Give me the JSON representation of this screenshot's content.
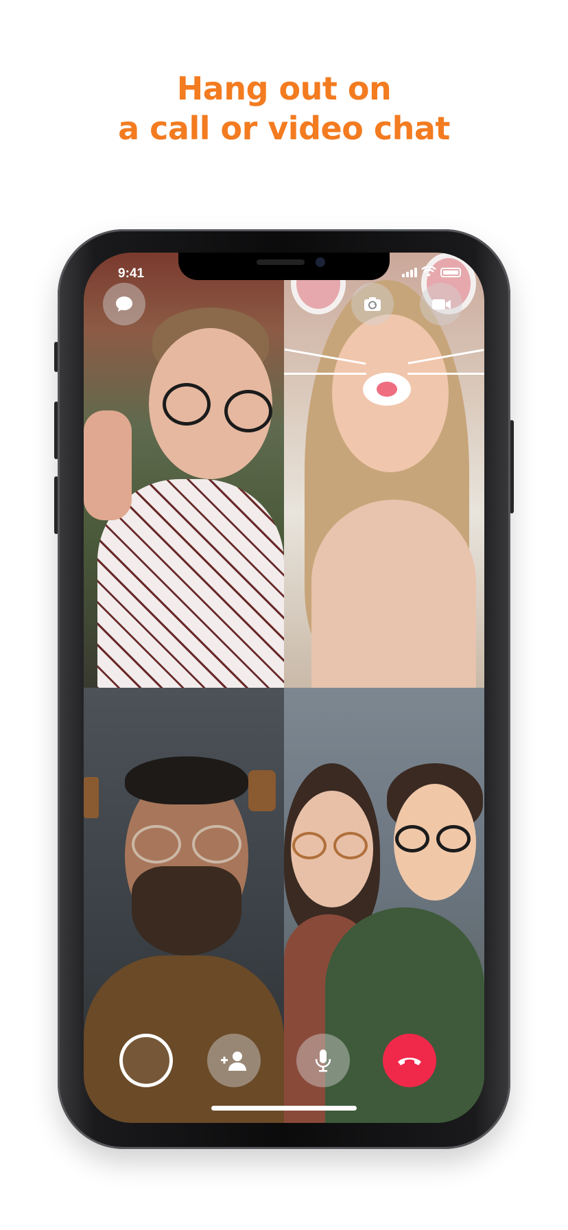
{
  "headline": {
    "line1": "Hang out on",
    "line2": "a call or video chat"
  },
  "status_bar": {
    "time": "9:41",
    "icons": [
      "signal-icon",
      "wifi-icon",
      "battery-icon"
    ]
  },
  "top_controls": {
    "icons": [
      "chat-bubble-icon",
      "flip-camera-icon",
      "video-camera-icon"
    ]
  },
  "bottom_controls": {
    "icons": [
      "capture-icon",
      "add-person-icon",
      "microphone-icon",
      "end-call-icon"
    ]
  },
  "colors": {
    "headline": "#f37b20",
    "end_call": "#f0284a"
  }
}
